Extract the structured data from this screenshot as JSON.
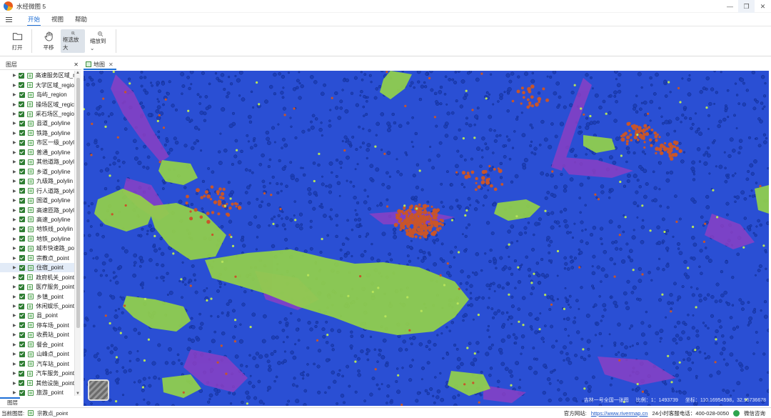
{
  "window": {
    "title": "水经微图 5"
  },
  "menu": {
    "items": [
      "开始",
      "视图",
      "帮助"
    ]
  },
  "ribbon": {
    "open_label": "打开",
    "pan_label": "平移",
    "zoom_box_label": "框选放大",
    "zoom_to_label": "缩放到"
  },
  "layer_panel": {
    "title": "图层",
    "bottom_tab": "图层",
    "selected_index": 20,
    "layers": [
      "高速服务区域_reg",
      "大学区域_regio",
      "岛屿_region",
      "操场区域_regic",
      "采石场区_regio",
      "县道_polyline",
      "铁路_polyline",
      "市区一级_polyl",
      "普通_polyline",
      "其他道路_polyl",
      "乡道_polyline",
      "九级路_polylin",
      "行人道路_polyl",
      "国道_polyline",
      "高速匝路_polyl",
      "高速_polyline",
      "地铁线_polylin",
      "地铁_polyline",
      "城市快速路_po",
      "宗教点_point",
      "住宿_point",
      "政府机关_point",
      "医疗服务_point",
      "乡镇_point",
      "休闲娱乐_point",
      "县_point",
      "停车场_point",
      "收费站_point",
      "餐会_point",
      "山峰点_point",
      "汽车站_point",
      "汽车服务_point",
      "其他设施_point",
      "旅游_point"
    ]
  },
  "doc_tab": {
    "label": "地图"
  },
  "map": {
    "credit": "吉林一号全国一张图",
    "scale": "比例：1：1493739",
    "coords": "坐标：110.16954598，32.95736678",
    "colors": {
      "background": "#2a4fd4",
      "points": "#1d3fb8",
      "vegetation": "#93d14a",
      "purple": "#8a3fc4",
      "settlement": "#c8552a"
    }
  },
  "status": {
    "current_layer_label": "当前图层:",
    "current_layer": "宗教点_point",
    "site_label": "官方网站:",
    "site_url": "https://www.rivermap.cn",
    "hotline": "24小时客服电话：400-028-0050",
    "wechat": "微信咨询"
  }
}
